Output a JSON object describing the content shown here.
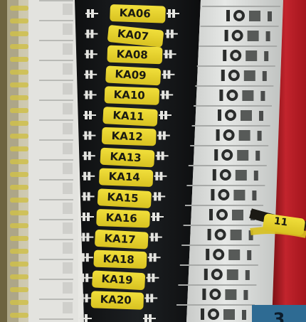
{
  "photo": {
    "labels": [
      "KA06",
      "KA07",
      "KA08",
      "KA09",
      "KA10",
      "KA11",
      "KA12",
      "KA13",
      "KA14",
      "KA15",
      "KA16",
      "KA17",
      "KA18",
      "KA19",
      "KA20"
    ],
    "cable_marker": "11",
    "corner_badge": "3"
  },
  "colors": {
    "label_yellow": "#e7d22c",
    "dark_strip": "#15171a",
    "terminal_white": "#d8dad8",
    "red_panel": "#b8202a",
    "badge_blue": "#2e6b93"
  }
}
